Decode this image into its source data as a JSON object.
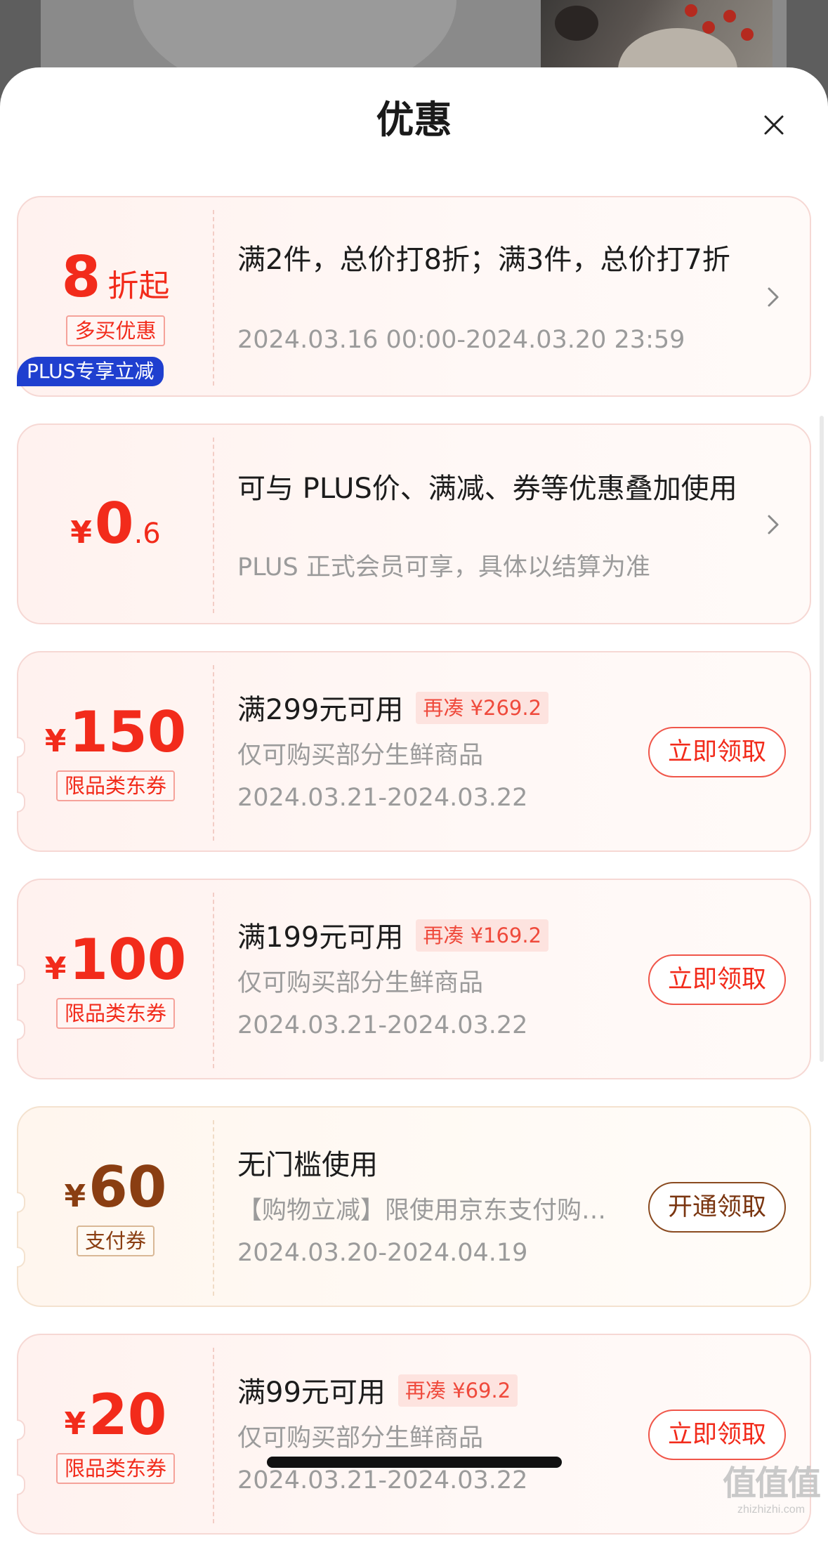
{
  "sheet": {
    "title": "优惠"
  },
  "offers": [
    {
      "amount": "8",
      "amount_suffix": "折起",
      "tag": "多买优惠",
      "title": "满2件，总价打8折；满3件，总价打7折",
      "subtitle": "2024.03.16 00:00-2024.03.20 23:59"
    },
    {
      "badge": "PLUS专享立减",
      "currency": "¥",
      "amount": "0",
      "amount_frac": ".6",
      "title": "可与 PLUS价、满减、券等优惠叠加使用",
      "subtitle": "PLUS 正式会员可享，具体以结算为准"
    }
  ],
  "coupons": [
    {
      "currency": "¥",
      "amount": "150",
      "tag": "限品类东券",
      "title": "满299元可用",
      "gap": "再凑 ¥269.2",
      "desc": "仅可购买部分生鲜商品",
      "validity": "2024.03.21-2024.03.22",
      "button": "立即领取"
    },
    {
      "currency": "¥",
      "amount": "100",
      "tag": "限品类东券",
      "title": "满199元可用",
      "gap": "再凑 ¥169.2",
      "desc": "仅可购买部分生鲜商品",
      "validity": "2024.03.21-2024.03.22",
      "button": "立即领取"
    },
    {
      "currency": "¥",
      "amount": "60",
      "tag": "支付券",
      "title": "无门槛使用",
      "desc": "【购物立减】限使用京东支付购…",
      "validity": "2024.03.20-2024.04.19",
      "button": "开通领取"
    },
    {
      "currency": "¥",
      "amount": "20",
      "tag": "限品类东券",
      "title": "满99元可用",
      "gap": "再凑 ¥69.2",
      "desc": "仅可购买部分生鲜商品",
      "validity": "2024.03.21-2024.03.22",
      "button": "立即领取"
    }
  ],
  "watermark": {
    "logo": "值值值",
    "site": "zhizhizhi.com"
  },
  "colors": {
    "accent": "#f22b1b",
    "gold": "#8a3e12",
    "plus_badge": "#1f3fcf"
  }
}
